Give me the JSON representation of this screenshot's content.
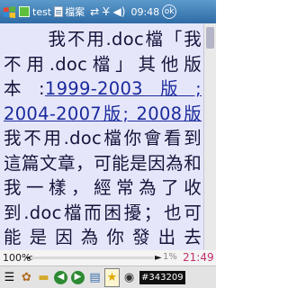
{
  "titlebar": {
    "app_title": "test",
    "second_title": "檔案",
    "sync_glyph": "⇄",
    "signal_glyph": "Y̶",
    "volume_glyph": "◀)",
    "time": "09:48",
    "close_glyph": "ok",
    "start_icon": "windows-flag-icon",
    "app_icon": "green-app-icon",
    "doc_icon": "document-icon"
  },
  "reader": {
    "segments": [
      {
        "text": "我不用.doc檔「我不用.doc檔」其他版本:",
        "link": false
      },
      {
        "text": "1999-2003版; 2004-2007版; 2008版",
        "link": true
      },
      {
        "text": "我不用.doc檔你會看到這篇文章，可能是因為和我一樣，經常為了收到.doc檔而困擾；也可能是因為你發出去的.doc檔造成了別",
        "link": false
      }
    ]
  },
  "progress": {
    "left_percent_label": "100%",
    "position_fraction": 0.01,
    "handle_left": "◄",
    "handle_right": "►",
    "right_percent_label": "1%",
    "clock": "21:49"
  },
  "toolbar": {
    "buttons": [
      {
        "name": "menu-icon",
        "glyph": "☰"
      },
      {
        "name": "settings-icon",
        "glyph": "✿"
      },
      {
        "name": "folder-icon",
        "glyph": "▬"
      },
      {
        "name": "back-icon",
        "glyph": "◀"
      },
      {
        "name": "forward-icon",
        "glyph": "▶"
      },
      {
        "name": "bookmarks-icon",
        "glyph": "▤"
      },
      {
        "name": "star-icon",
        "glyph": "★"
      },
      {
        "name": "binoculars-icon",
        "glyph": "◉"
      }
    ],
    "counter": "#343209"
  },
  "colors": {
    "titlebar": "#2e6ba6",
    "reader_background": "#e6e6fb",
    "text": "#14143a",
    "link": "#1a2a9b",
    "clock_accent": "#c0306a"
  }
}
